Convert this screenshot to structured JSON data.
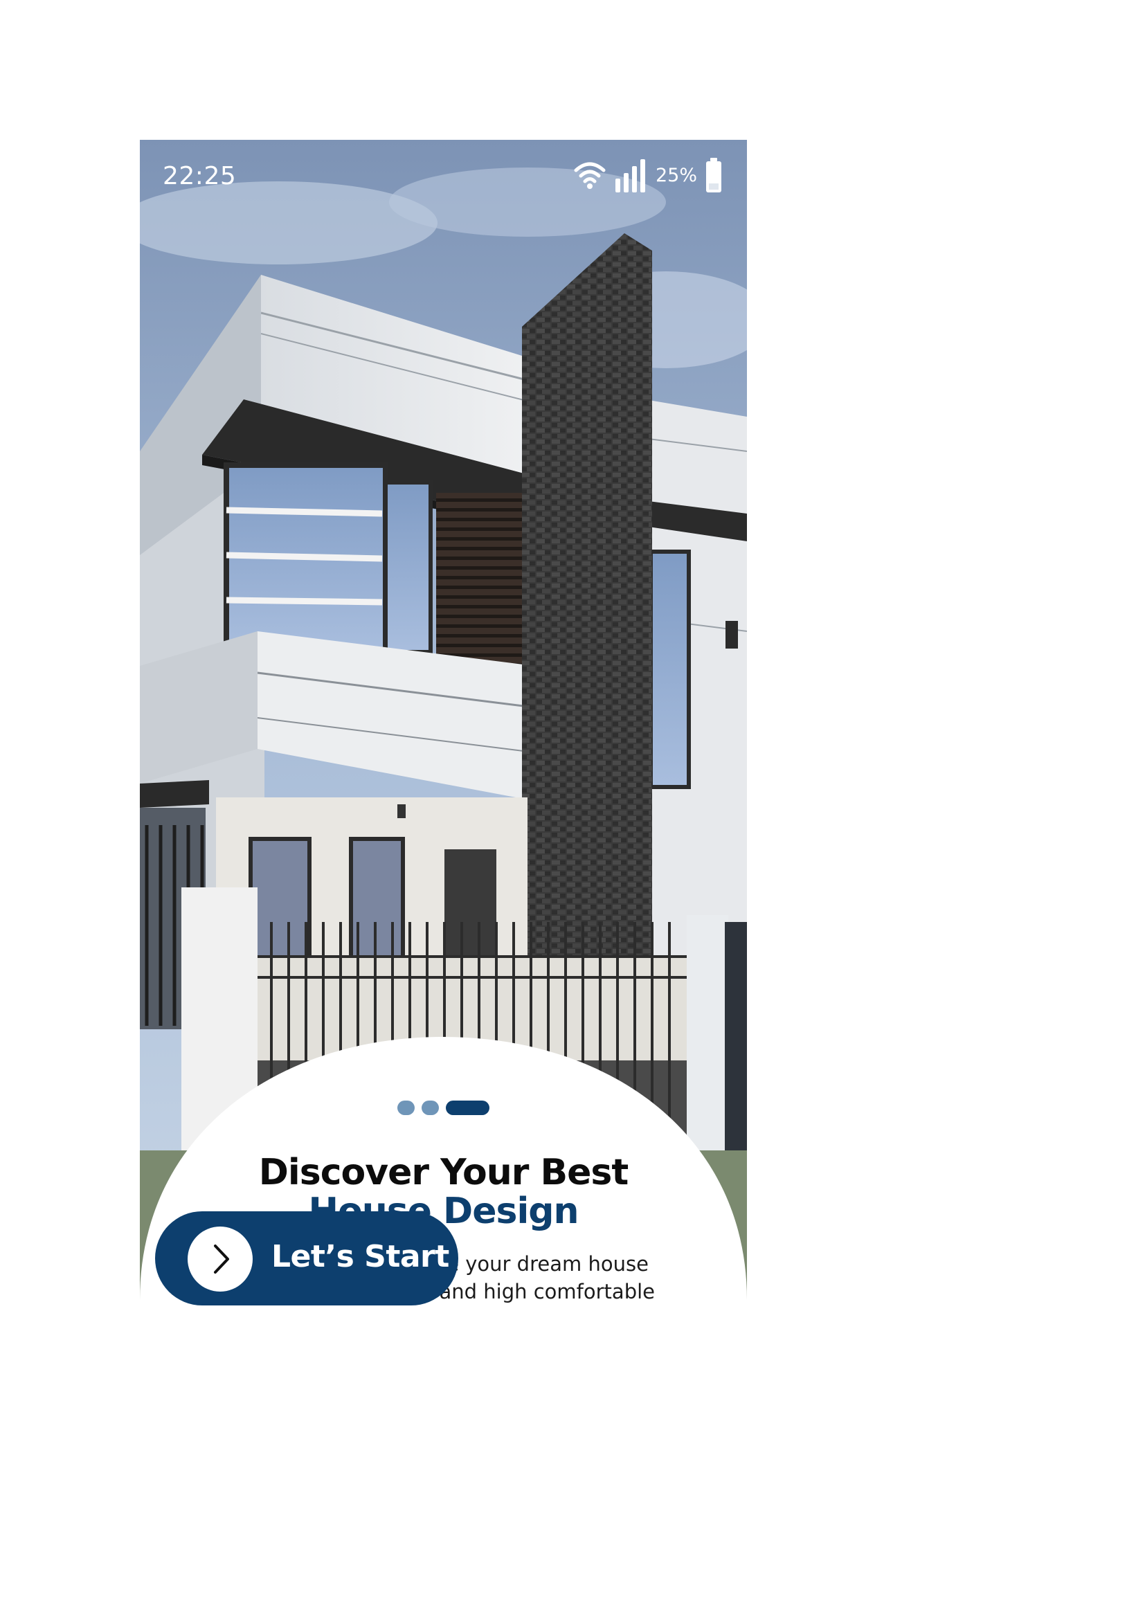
{
  "status_bar": {
    "time": "22:25",
    "battery_percent": "25%",
    "icons": [
      "wifi-icon",
      "signal-icon",
      "battery-icon"
    ]
  },
  "hero": {
    "image": "modern-two-storey-house-photo"
  },
  "pager": {
    "count": 3,
    "active_index": 2
  },
  "onboarding": {
    "title_line1": "Discover Your Best",
    "title_line2": "House Design",
    "description_line1": "We Help You to create your dream house",
    "description_line2": "with one ecosystem and high comfortable"
  },
  "cta": {
    "label": "Let’s Start",
    "icon": "chevron-right-icon"
  },
  "colors": {
    "primary": "#0d3f6e",
    "dot_inactive": "#6f95b8",
    "title_dark": "#0c0c0c",
    "background": "#ffffff"
  }
}
